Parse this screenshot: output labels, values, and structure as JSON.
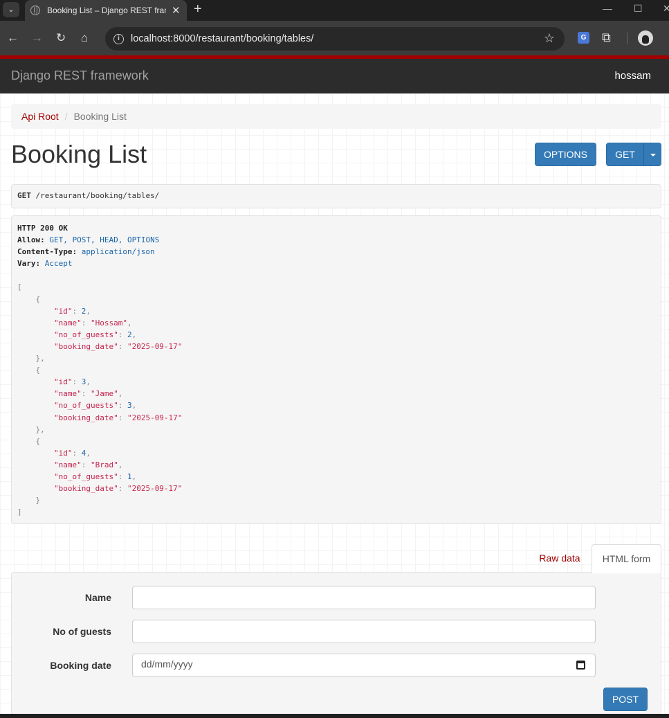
{
  "browser": {
    "tab_title": "Booking List – Django REST framework",
    "url": "localhost:8000/restaurant/booking/tables/",
    "icons": {
      "back": "arrow-left-icon",
      "forward": "arrow-right-icon",
      "reload": "reload-icon",
      "home": "home-icon",
      "bookmark": "star-icon",
      "translate": "translate-icon",
      "extensions": "puzzle-icon"
    }
  },
  "navbar": {
    "brand": "Django REST framework",
    "user": "hossam"
  },
  "breadcrumb": {
    "root": "Api Root",
    "separator": "/",
    "current": "Booking List"
  },
  "page": {
    "title": "Booking List",
    "options_label": "OPTIONS",
    "get_label": "GET"
  },
  "request": {
    "method": "GET",
    "path": "/restaurant/booking/tables/"
  },
  "response": {
    "status": "HTTP 200 OK",
    "headers": [
      {
        "key": "Allow:",
        "value": "GET, POST, HEAD, OPTIONS"
      },
      {
        "key": "Content-Type:",
        "value": "application/json"
      },
      {
        "key": "Vary:",
        "value": "Accept"
      }
    ],
    "bookings": [
      {
        "id": "2",
        "name": "\"Hossam\"",
        "no_of_guests": "2",
        "booking_date": "\"2025-09-17\""
      },
      {
        "id": "3",
        "name": "\"Jame\"",
        "no_of_guests": "3",
        "booking_date": "\"2025-09-17\""
      },
      {
        "id": "4",
        "name": "\"Brad\"",
        "no_of_guests": "1",
        "booking_date": "\"2025-09-17\""
      }
    ],
    "keys": {
      "id": "\"id\"",
      "name": "\"name\"",
      "no_of_guests": "\"no_of_guests\"",
      "booking_date": "\"booking_date\""
    }
  },
  "form": {
    "tab_raw": "Raw data",
    "tab_html": "HTML form",
    "name_label": "Name",
    "name_value": "",
    "guests_label": "No of guests",
    "guests_value": "",
    "date_label": "Booking date",
    "date_placeholder": "dd/mm/yyyy",
    "submit_label": "POST"
  },
  "colors": {
    "brand_red": "#a30000",
    "button_blue": "#337ab7",
    "navbar_bg": "#2c2c2c"
  }
}
